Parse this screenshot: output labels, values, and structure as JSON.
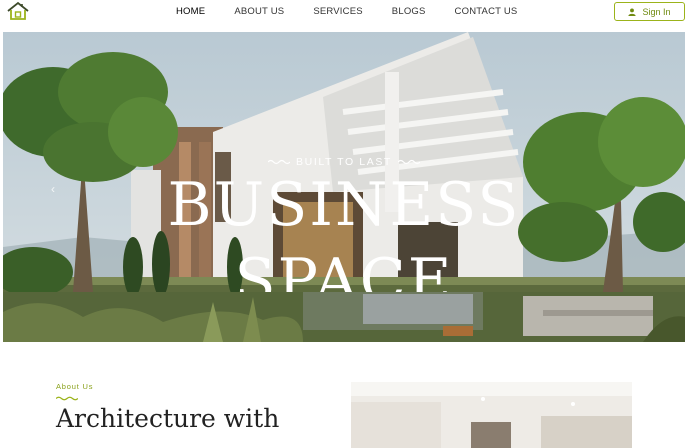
{
  "header": {
    "logo_icon": "house-logo-icon",
    "nav": [
      {
        "label": "HOME",
        "active": true
      },
      {
        "label": "ABOUT US",
        "active": false
      },
      {
        "label": "SERVICES",
        "active": false
      },
      {
        "label": "BLOGS",
        "active": false
      },
      {
        "label": "CONTACT US",
        "active": false
      }
    ],
    "signin_label": "Sign In",
    "signin_icon": "user-icon"
  },
  "hero": {
    "tagline": "BUILT TO LAST",
    "title_line1": "BUSINESS",
    "title_line2": "SPACE",
    "prev_icon": "chevron-left-icon"
  },
  "about": {
    "label": "About Us",
    "title": "Architecture with"
  },
  "colors": {
    "accent": "#9bb31a",
    "accent_text": "#6f8a10"
  }
}
